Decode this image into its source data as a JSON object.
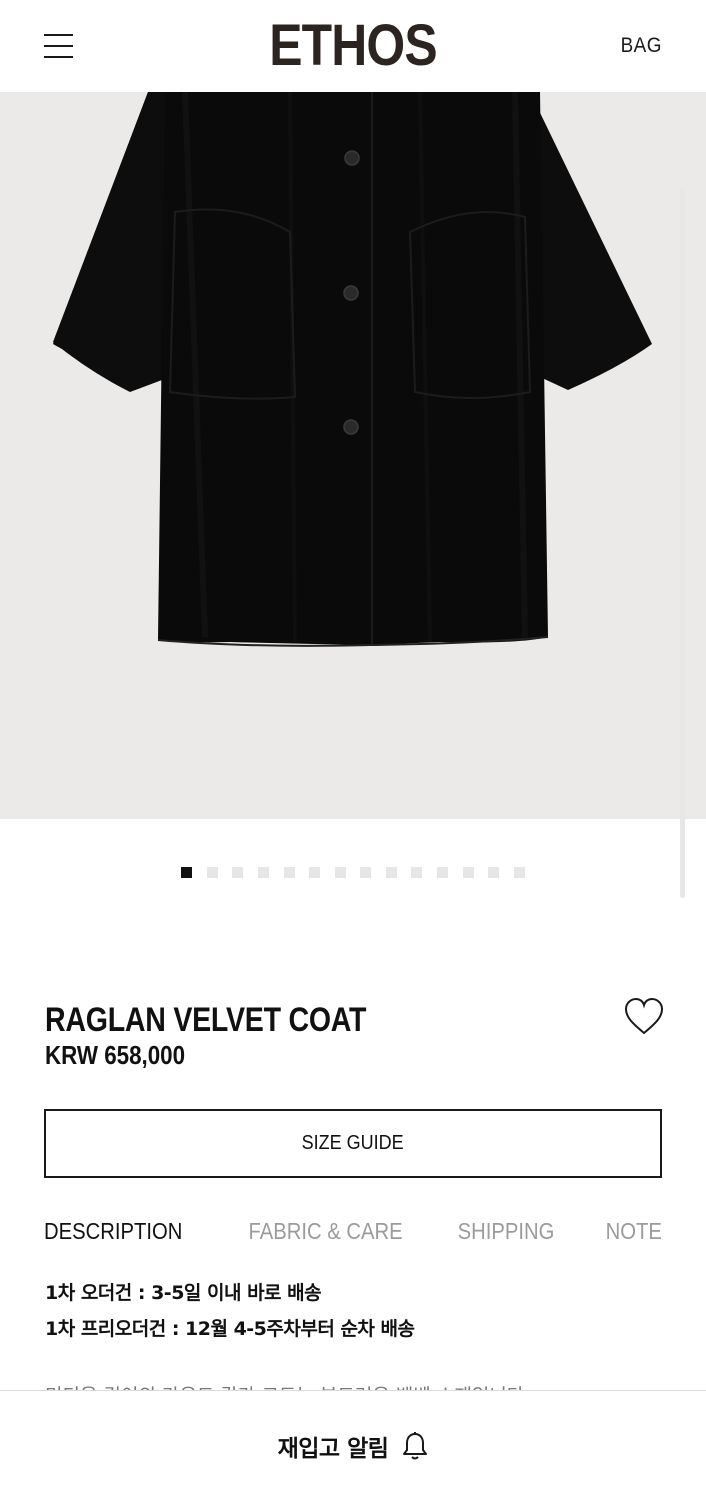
{
  "header": {
    "brand": "ETHOS",
    "bag_label": "BAG"
  },
  "gallery": {
    "total_images": 14,
    "active_index": 0
  },
  "product": {
    "name": "RAGLAN VELVET COAT",
    "price": "KRW 658,000"
  },
  "size_guide_label": "SIZE GUIDE",
  "tabs": [
    {
      "label": "DESCRIPTION",
      "active": true
    },
    {
      "label": "FABRIC & CARE",
      "active": false
    },
    {
      "label": "SHIPPING",
      "active": false
    },
    {
      "label": "NOTE",
      "active": false
    }
  ],
  "description": {
    "line1": "1차 오더건 : 3-5일 이내 바로 배송",
    "line2": "1차 프리오더건 : 12월 4-5주차부터 순차 배송",
    "line3_partial": "미디움 길이의 라운드 칼라 코트는 부드러운 벨벳 소재입니다"
  },
  "bottom_bar": {
    "restock_label": "재입고 알림"
  },
  "colors": {
    "brand": "#2b2420",
    "hero_bg": "#ebeae8",
    "inactive_tab": "#9b9b9b",
    "dot_inactive": "#e6e6e6",
    "dot_active": "#111111"
  }
}
